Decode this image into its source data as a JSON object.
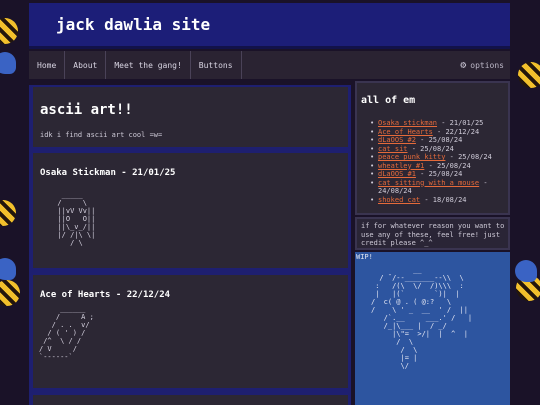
{
  "site": {
    "title": "jack dawlia site"
  },
  "nav": {
    "items": [
      "Home",
      "About",
      "Meet the gang!",
      "Buttons"
    ],
    "options_label": "options"
  },
  "main": {
    "heading": "ascii art!!",
    "intro": "idk i find ascii art cool =w=",
    "entries": [
      {
        "title": "Osaka Stickman - 21/01/25",
        "art": "   _____\n  /     \\\n  ||vV Vv||\n  ||O   O||\n  ||\\_v_/||\n  |/ /|\\ \\|\n     / \\"
      },
      {
        "title": "Ace of Hearts - 22/12/24",
        "art": "     ______\n    /     A ;\n   / . .  v/\n  / ( ' ) /\n /^  \\ / /\n/ V     /\n`------`"
      }
    ]
  },
  "sidebar": {
    "heading": "all of em",
    "items": [
      {
        "link": "Osaka stickman",
        "date": " - 21/01/25"
      },
      {
        "link": "Ace of Hearts",
        "date": " - 22/12/24"
      },
      {
        "link": "dLaOOS #2",
        "date": " - 25/08/24"
      },
      {
        "link": "cat sit",
        "date": " - 25/08/24"
      },
      {
        "link": "peace punk kitty",
        "date": " - 25/08/24"
      },
      {
        "link": "wheatley #1",
        "date": " - 25/08/24"
      },
      {
        "link": "dLaOOS #1",
        "date": " - 25/08/24"
      },
      {
        "link": "cat sitting with a mouse",
        "date": " - 24/08/24"
      },
      {
        "link": "shoked cat",
        "date": " - 18/08/24"
      }
    ],
    "note": "if for whatever reason you want to use any of these, feel free! just credit please ^_^",
    "wip_label": "WIP!",
    "wip_art": "          __\n  / ¯/--_______--\\\\  \\\n :   /(\\  \\/  /)\\\\\\  :\n |   |(`       `)|  |\n/  c( @ . ( @:?   \\\n/    \\ ' _  __  ' /  ||\n   /`.__     ___.' /   |\n   /_|\\___ |  / _/\n     |\\\"=  >/|  |  ^  |\n      /  \\\n       /  \\\n       |= |\n       \\/"
  }
}
